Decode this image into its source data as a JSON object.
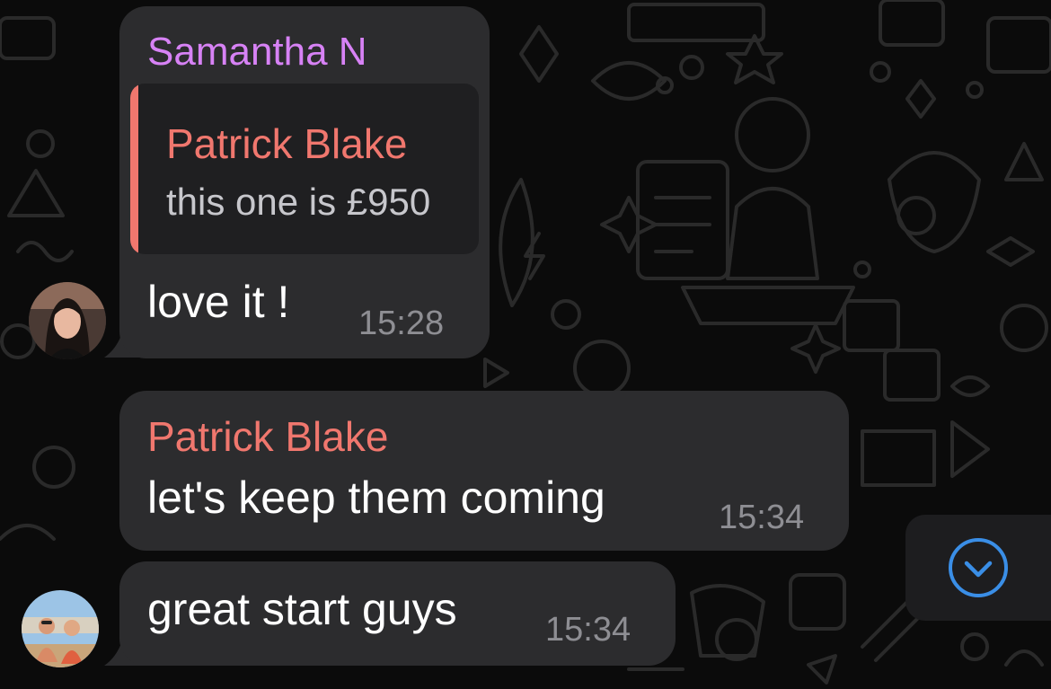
{
  "colors": {
    "background": "#0b0b0b",
    "bubble": "#2c2c2e",
    "quote_background": "#1f1f21",
    "sender_samantha": "#d782f5",
    "sender_patrick": "#f0776e",
    "timestamp": "#8e8e93",
    "scroll_accent": "#3a8ee6"
  },
  "messages": [
    {
      "sender": "Samantha N",
      "reply_to": {
        "sender": "Patrick Blake",
        "text": "this one is £950"
      },
      "text": "love it !",
      "time": "15:28"
    },
    {
      "sender": "Patrick Blake",
      "text": "let's keep them coming",
      "time": "15:34"
    },
    {
      "text": "great start guys",
      "time": "15:34"
    }
  ],
  "scroll_down": {
    "icon": "chevron-down-circle-icon"
  }
}
